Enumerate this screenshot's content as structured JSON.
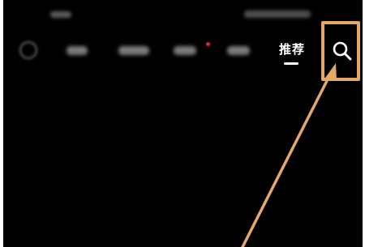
{
  "colors": {
    "screen_background": "#000000",
    "annotation_orange": "#e6a868",
    "notification_red": "#e02a3a"
  },
  "nav": {
    "active_tab_label": "推荐",
    "blurred_tab_count": 4,
    "search_icon": "search-icon"
  },
  "annotation": {
    "highlight_target": "search-button"
  }
}
